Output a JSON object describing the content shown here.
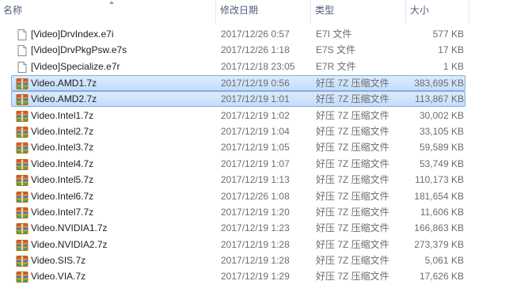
{
  "columns": {
    "name": "名称",
    "date": "修改日期",
    "type": "类型",
    "size": "大小"
  },
  "files": [
    {
      "name": "[Video]DrvIndex.e7i",
      "date": "2017/12/26 0:57",
      "type": "E7I 文件",
      "size": "577 KB",
      "icon": "document-icon",
      "selected": false
    },
    {
      "name": "[Video]DrvPkgPsw.e7s",
      "date": "2017/12/26 1:18",
      "type": "E7S 文件",
      "size": "17 KB",
      "icon": "document-icon",
      "selected": false
    },
    {
      "name": "[Video]Specialize.e7r",
      "date": "2017/12/18 23:05",
      "type": "E7R 文件",
      "size": "1 KB",
      "icon": "document-icon",
      "selected": false
    },
    {
      "name": "Video.AMD1.7z",
      "date": "2017/12/19 0:56",
      "type": "好压 7Z 压缩文件",
      "size": "383,695 KB",
      "icon": "archive-icon",
      "selected": true
    },
    {
      "name": "Video.AMD2.7z",
      "date": "2017/12/19 1:01",
      "type": "好压 7Z 压缩文件",
      "size": "113,867 KB",
      "icon": "archive-icon",
      "selected": true
    },
    {
      "name": "Video.Intel1.7z",
      "date": "2017/12/19 1:02",
      "type": "好压 7Z 压缩文件",
      "size": "30,002 KB",
      "icon": "archive-icon",
      "selected": false
    },
    {
      "name": "Video.Intel2.7z",
      "date": "2017/12/19 1:04",
      "type": "好压 7Z 压缩文件",
      "size": "33,105 KB",
      "icon": "archive-icon",
      "selected": false
    },
    {
      "name": "Video.Intel3.7z",
      "date": "2017/12/19 1:05",
      "type": "好压 7Z 压缩文件",
      "size": "59,589 KB",
      "icon": "archive-icon",
      "selected": false
    },
    {
      "name": "Video.Intel4.7z",
      "date": "2017/12/19 1:07",
      "type": "好压 7Z 压缩文件",
      "size": "53,749 KB",
      "icon": "archive-icon",
      "selected": false
    },
    {
      "name": "Video.Intel5.7z",
      "date": "2017/12/19 1:13",
      "type": "好压 7Z 压缩文件",
      "size": "110,173 KB",
      "icon": "archive-icon",
      "selected": false
    },
    {
      "name": "Video.Intel6.7z",
      "date": "2017/12/26 1:08",
      "type": "好压 7Z 压缩文件",
      "size": "181,654 KB",
      "icon": "archive-icon",
      "selected": false
    },
    {
      "name": "Video.Intel7.7z",
      "date": "2017/12/19 1:20",
      "type": "好压 7Z 压缩文件",
      "size": "11,606 KB",
      "icon": "archive-icon",
      "selected": false
    },
    {
      "name": "Video.NVIDIA1.7z",
      "date": "2017/12/19 1:23",
      "type": "好压 7Z 压缩文件",
      "size": "166,863 KB",
      "icon": "archive-icon",
      "selected": false
    },
    {
      "name": "Video.NVIDIA2.7z",
      "date": "2017/12/19 1:28",
      "type": "好压 7Z 压缩文件",
      "size": "273,379 KB",
      "icon": "archive-icon",
      "selected": false
    },
    {
      "name": "Video.SIS.7z",
      "date": "2017/12/19 1:28",
      "type": "好压 7Z 压缩文件",
      "size": "5,061 KB",
      "icon": "archive-icon",
      "selected": false
    },
    {
      "name": "Video.VIA.7z",
      "date": "2017/12/19 1:29",
      "type": "好压 7Z 压缩文件",
      "size": "17,626 KB",
      "icon": "archive-icon",
      "selected": false
    }
  ]
}
